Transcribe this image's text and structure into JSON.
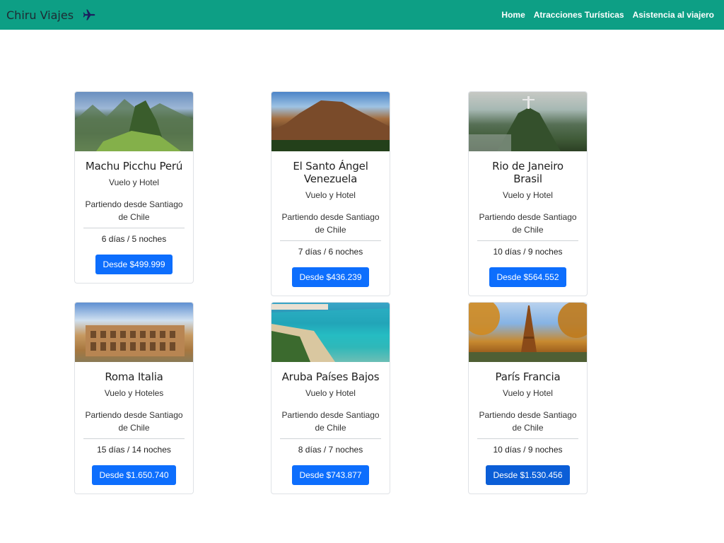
{
  "navbar": {
    "brand": "Chiru Viajes",
    "brand_icon": "airplane-icon",
    "links": [
      "Home",
      "Atracciones Turísticas",
      "Asistencia al viajero"
    ],
    "color": "#0d9f85"
  },
  "cards": [
    {
      "title": "Machu Picchu Perú",
      "subtitle": "Vuelo y Hotel",
      "departure": "Partiendo desde Santiago de Chile",
      "duration": "6 días / 5 noches",
      "price": "Desde $499.999"
    },
    {
      "title": "El Santo Ángel Venezuela",
      "subtitle": "Vuelo y Hotel",
      "departure": "Partiendo desde Santiago de Chile",
      "duration": "7 días / 6 noches",
      "price": "Desde $436.239"
    },
    {
      "title": "Rio de Janeiro Brasil",
      "subtitle": "Vuelo y Hotel",
      "departure": "Partiendo desde Santiago de Chile",
      "duration": "10 días / 9 noches",
      "price": "Desde $564.552"
    },
    {
      "title": "Roma Italia",
      "subtitle": "Vuelo y Hoteles",
      "departure": "Partiendo desde Santiago de Chile",
      "duration": "15 días / 14 noches",
      "price": "Desde $1.650.740"
    },
    {
      "title": "Aruba Países Bajos",
      "subtitle": "Vuelo y Hotel",
      "departure": "Partiendo desde Santiago de Chile",
      "duration": "8 días / 7 noches",
      "price": "Desde $743.877"
    },
    {
      "title": "París Francia",
      "subtitle": "Vuelo y Hotel",
      "departure": "Partiendo desde Santiago de Chile",
      "duration": "10 días / 9 noches",
      "price": "Desde $1.530.456"
    }
  ],
  "button_color": "#0d6efd"
}
